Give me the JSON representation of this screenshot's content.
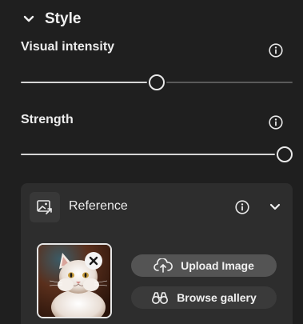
{
  "style_section": {
    "title": "Style",
    "expand_icon": "chevron-down-icon"
  },
  "visual_intensity": {
    "label": "Visual intensity",
    "info_icon": "info-icon",
    "value_fraction": 0.5
  },
  "strength": {
    "label": "Strength",
    "info_icon": "info-icon",
    "value_fraction": 1.0
  },
  "reference": {
    "title": "Reference",
    "icon": "image-reference-icon",
    "info_icon": "info-icon",
    "collapse_icon": "chevron-down-icon",
    "thumbnail_alt": "white cat reference image",
    "remove_icon": "close-icon",
    "upload_label": "Upload Image",
    "upload_icon": "cloud-upload-icon",
    "browse_label": "Browse gallery",
    "browse_icon": "binoculars-icon"
  },
  "colors": {
    "background": "#1f1f1f",
    "card": "#2d2d2d",
    "track_active": "#d6d6d6",
    "track_inactive": "#5a5a5a",
    "upload_button": "#545454",
    "browse_button": "#3a3a3a"
  }
}
